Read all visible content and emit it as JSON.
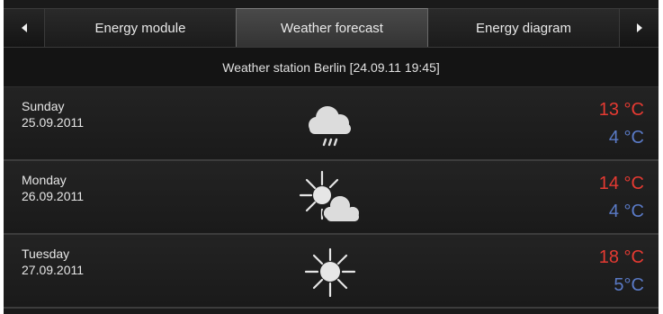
{
  "tabs": {
    "prev_icon": "triangle-left-icon",
    "next_icon": "triangle-right-icon",
    "items": [
      {
        "label": "Energy module",
        "active": false
      },
      {
        "label": "Weather forecast",
        "active": true
      },
      {
        "label": "Energy diagram",
        "active": false
      }
    ]
  },
  "station": {
    "title": "Weather station Berlin [24.09.11 19:45]"
  },
  "forecast": [
    {
      "day": "Sunday",
      "date": "25.09.2011",
      "icon": "cloud-rain-icon",
      "max": "13 °C",
      "min": "4 °C"
    },
    {
      "day": "Monday",
      "date": "26.09.2011",
      "icon": "sun-cloud-icon",
      "max": "14 °C",
      "min": "4 °C"
    },
    {
      "day": "Tuesday",
      "date": "27.09.2011",
      "icon": "sun-icon",
      "max": "18 °C",
      "min": "5°C"
    }
  ],
  "colors": {
    "max_temp": "#e53a32",
    "min_temp": "#5a7ac6",
    "background": "#1a1a1a"
  }
}
